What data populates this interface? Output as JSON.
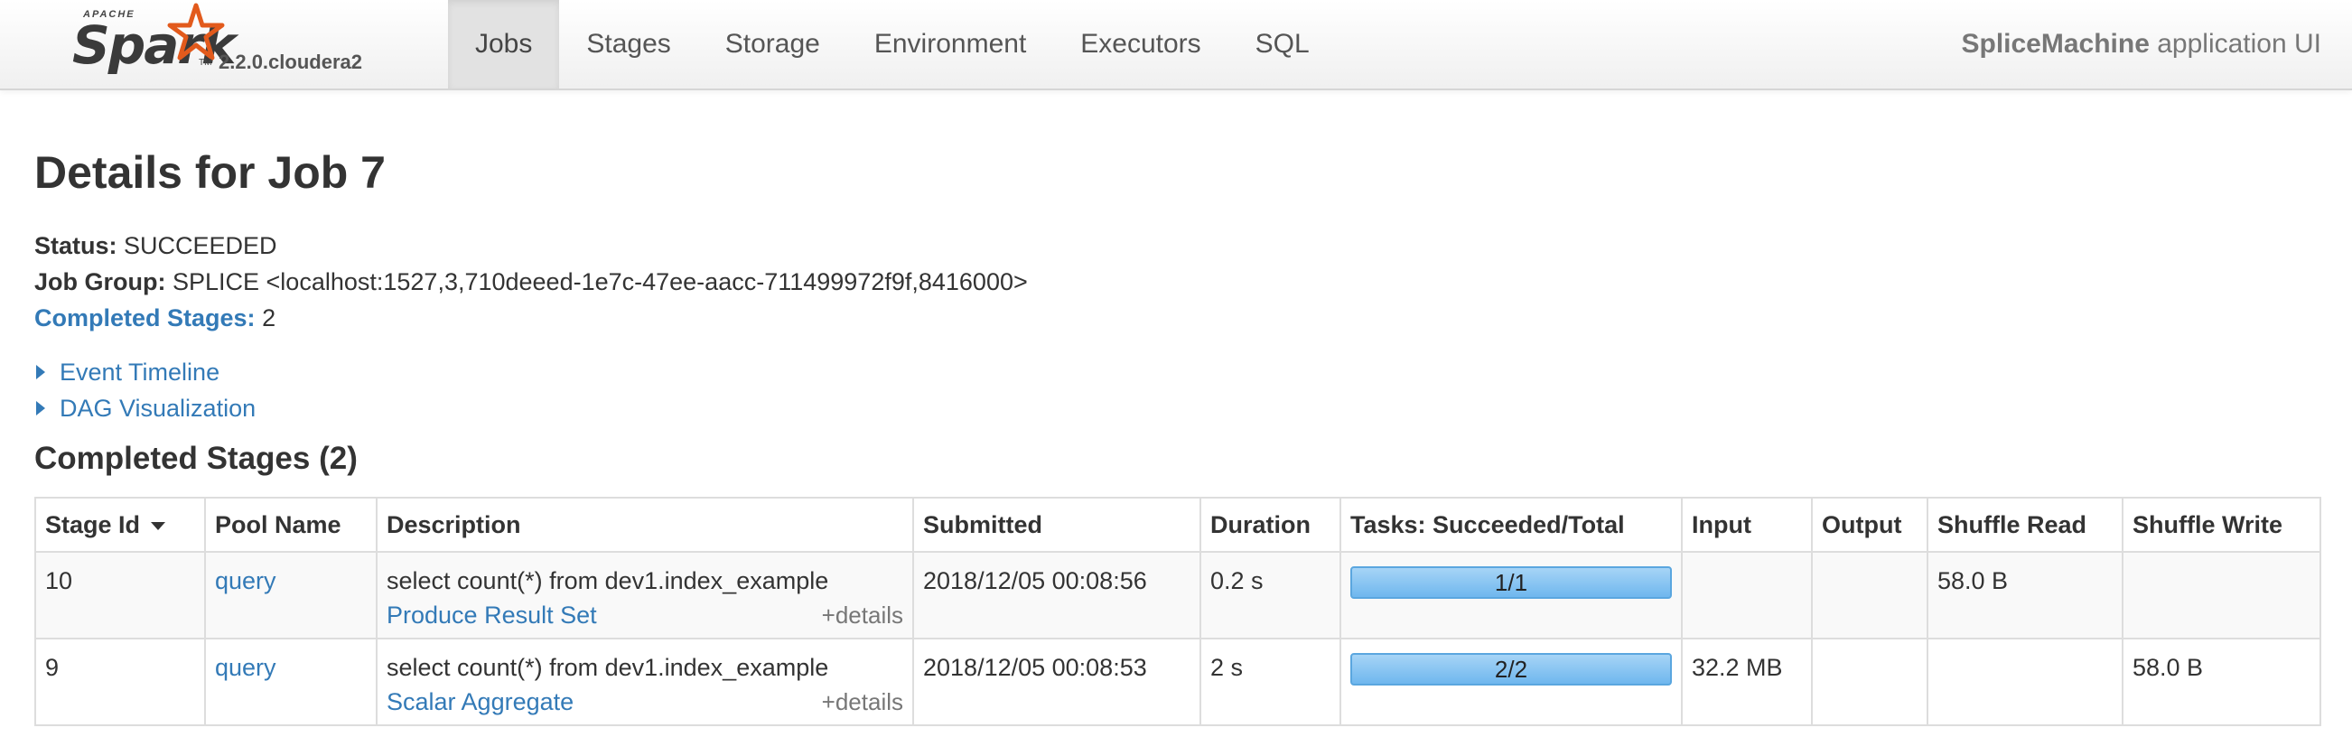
{
  "brand": {
    "apache": "APACHE",
    "spark": "Spark",
    "trademark": "TM",
    "version": "2.2.0.cloudera2"
  },
  "nav": {
    "tabs": [
      {
        "label": "Jobs",
        "active": true
      },
      {
        "label": "Stages",
        "active": false
      },
      {
        "label": "Storage",
        "active": false
      },
      {
        "label": "Environment",
        "active": false
      },
      {
        "label": "Executors",
        "active": false
      },
      {
        "label": "SQL",
        "active": false
      }
    ]
  },
  "app": {
    "name": "SpliceMachine",
    "suffix": " application UI"
  },
  "page": {
    "title": "Details for Job 7"
  },
  "summary": {
    "status_label": "Status:",
    "status_value": "SUCCEEDED",
    "job_group_label": "Job Group:",
    "job_group_value": "SPLICE <localhost:1527,3,710deeed-1e7c-47ee-aacc-711499972f9f,8416000>",
    "completed_stages_label": "Completed Stages:",
    "completed_stages_value": "2"
  },
  "toggles": {
    "event_timeline": "Event Timeline",
    "dag_visualization": "DAG Visualization"
  },
  "section": {
    "title": "Completed Stages (2)"
  },
  "table": {
    "headers": {
      "stage_id": "Stage Id",
      "pool_name": "Pool Name",
      "description": "Description",
      "submitted": "Submitted",
      "duration": "Duration",
      "tasks": "Tasks: Succeeded/Total",
      "input": "Input",
      "output": "Output",
      "shuffle_read": "Shuffle Read",
      "shuffle_write": "Shuffle Write"
    },
    "rows": [
      {
        "stage_id": "10",
        "pool_name": "query",
        "description": "select count(*) from dev1.index_example",
        "description_link": "Produce Result Set",
        "details": "+details",
        "submitted": "2018/12/05 00:08:56",
        "duration": "0.2 s",
        "tasks_label": "1/1",
        "tasks_progress": 1.0,
        "input": "",
        "output": "",
        "shuffle_read": "58.0 B",
        "shuffle_write": ""
      },
      {
        "stage_id": "9",
        "pool_name": "query",
        "description": "select count(*) from dev1.index_example",
        "description_link": "Scalar Aggregate",
        "details": "+details",
        "submitted": "2018/12/05 00:08:53",
        "duration": "2 s",
        "tasks_label": "2/2",
        "tasks_progress": 1.0,
        "input": "32.2 MB",
        "output": "",
        "shuffle_read": "",
        "shuffle_write": "58.0 B"
      }
    ]
  },
  "colors": {
    "link": "#337ab7",
    "progress_fill": "#6fb7ee",
    "active_tab_bg": "#e2e2e2",
    "star": "#e25a1c"
  },
  "icons": {
    "logo": "spark-star-logo",
    "toggle": "triangle-right-icon",
    "sort": "caret-down-icon"
  }
}
